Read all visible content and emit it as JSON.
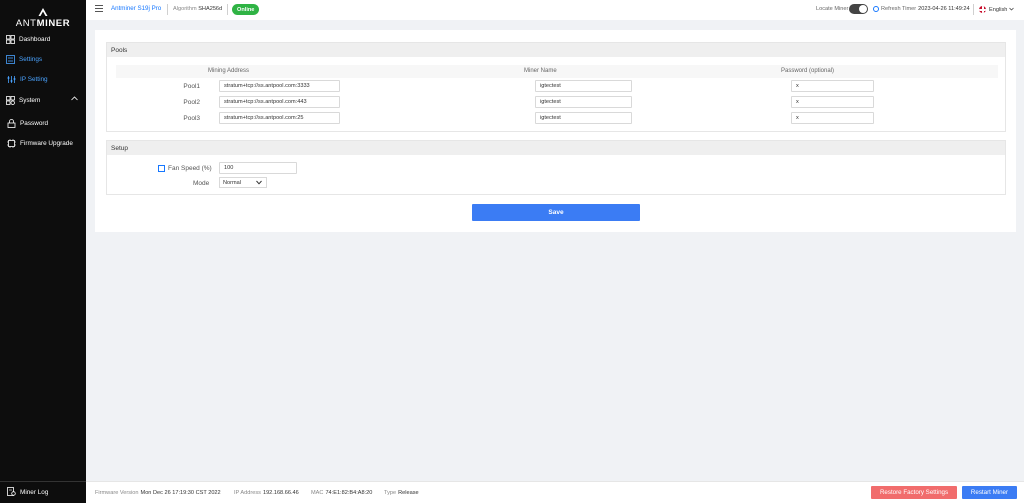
{
  "sidebar": {
    "logo": {
      "part1": "ANT",
      "part2": "MINER"
    },
    "items": [
      {
        "label": "Dashboard",
        "icon": "dashboard-icon"
      },
      {
        "label": "Settings",
        "icon": "settings-icon"
      },
      {
        "label": "IP Setting",
        "icon": "ip-setting-icon"
      },
      {
        "label": "System",
        "icon": "system-icon"
      },
      {
        "label": "Password",
        "icon": "lock-icon"
      },
      {
        "label": "Firmware Upgrade",
        "icon": "firmware-icon"
      }
    ],
    "miner_log": "Miner Log"
  },
  "topbar": {
    "model": "Antminer S19j Pro",
    "algorithm_label": "Algorithm",
    "algorithm_value": "SHA256d",
    "status": "Online",
    "locate_label": "Locate Miner",
    "refresh_label": "Refresh Timer",
    "refresh_value": "2023-04-26 11:49:24",
    "language": "English"
  },
  "pools": {
    "title": "Pools",
    "headers": [
      "Mining Address",
      "Miner Name",
      "Password (optional)"
    ],
    "rows": [
      {
        "label": "Pool1",
        "address": "stratum+tcp://ss.antpool.com:3333",
        "name": "igtectest",
        "password": "x"
      },
      {
        "label": "Pool2",
        "address": "stratum+tcp://ss.antpool.com:443",
        "name": "igtectest",
        "password": "x"
      },
      {
        "label": "Pool3",
        "address": "stratum+tcp://ss.antpool.com:25",
        "name": "igtectest",
        "password": "x"
      }
    ]
  },
  "setup": {
    "title": "Setup",
    "fan_label": "Fan Speed (%)",
    "fan_value": "100",
    "mode_label": "Mode",
    "mode_value": "Normal"
  },
  "save_label": "Save",
  "footer": {
    "firmware_label": "Firmware Version",
    "firmware_value": "Mon Dec 26 17:19:30 CST 2022",
    "ip_label": "IP Address",
    "ip_value": "192.168.66.46",
    "mac_label": "MAC",
    "mac_value": "74:E1:82:B4:A8:20",
    "type_label": "Type",
    "type_value": "Release",
    "restore_label": "Restore Factory Settings",
    "restart_label": "Restart Miner"
  },
  "colors": {
    "accent": "#1677ff",
    "online": "#2fb344",
    "danger": "#f16c6c",
    "primary_button": "#3b7cf4",
    "sidebar": "#0d0d0d"
  }
}
